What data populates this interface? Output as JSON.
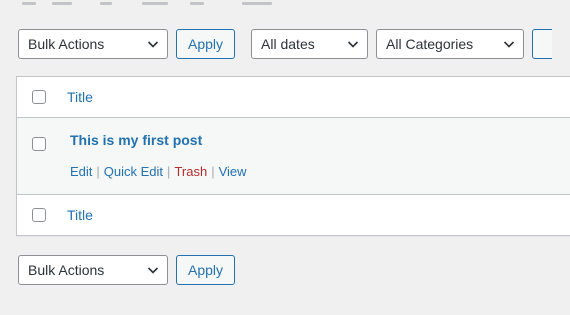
{
  "top_nav": {
    "bulk_actions": "Bulk Actions",
    "apply": "Apply",
    "dates": "All dates",
    "categories": "All Categories"
  },
  "table": {
    "header_title": "Title",
    "footer_title": "Title",
    "post": {
      "title": "This is my first post",
      "actions": {
        "edit": "Edit",
        "quick_edit": "Quick Edit",
        "trash": "Trash",
        "view": "View"
      }
    }
  },
  "bottom_nav": {
    "bulk_actions": "Bulk Actions",
    "apply": "Apply"
  },
  "colors": {
    "link": "#2271b1",
    "trash": "#b32d2e",
    "border": "#c3c4c7",
    "background": "#f0f0f1"
  },
  "icons": {
    "dropdown": "chevron-down-icon"
  }
}
